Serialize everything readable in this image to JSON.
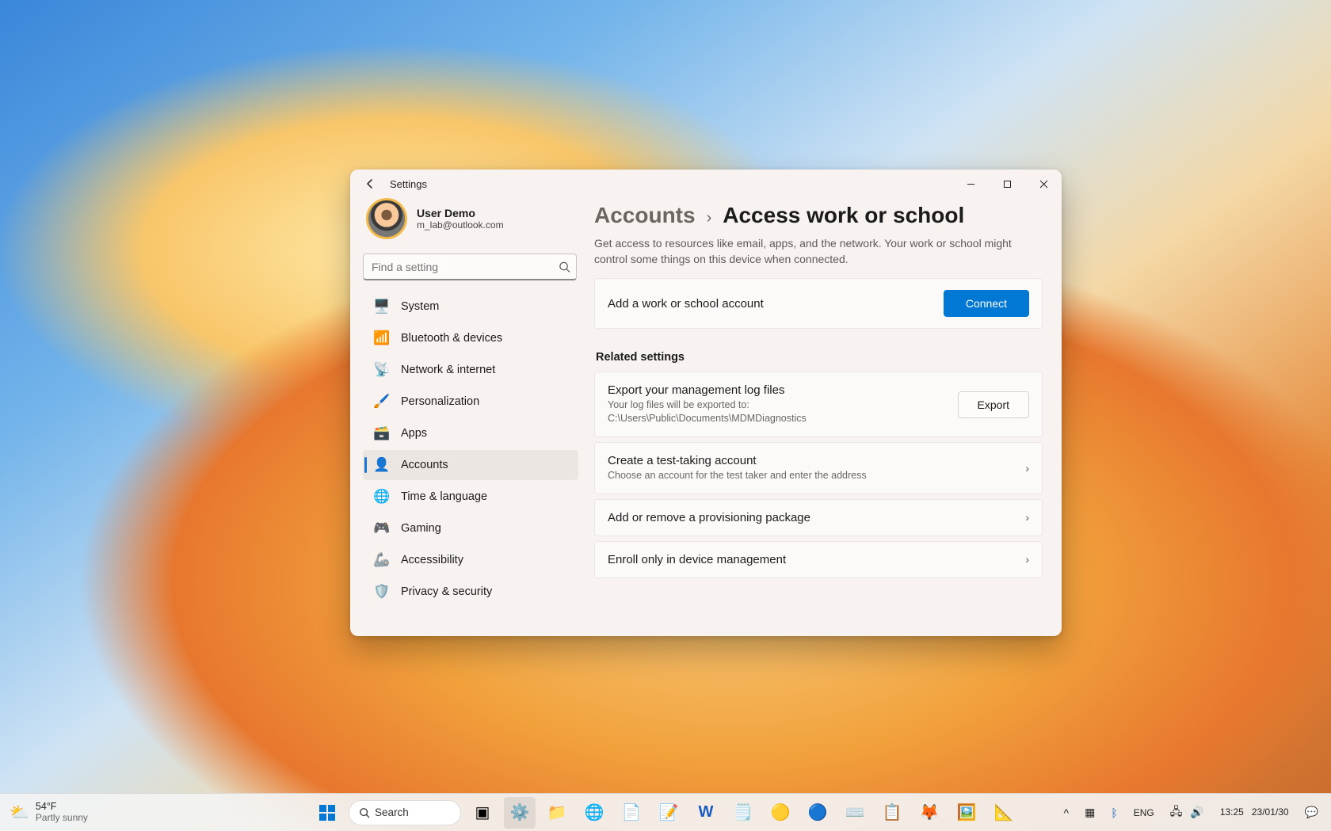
{
  "window": {
    "app_title": "Settings",
    "controls": {
      "minimize": "–",
      "maximize": "▢",
      "close": "✕"
    }
  },
  "profile": {
    "name": "User Demo",
    "email": "m_lab@outlook.com"
  },
  "search": {
    "placeholder": "Find a setting"
  },
  "sidebar": {
    "items": [
      {
        "id": "system",
        "label": "System",
        "glyph": "🖥️"
      },
      {
        "id": "bluetooth",
        "label": "Bluetooth & devices",
        "glyph": "📶"
      },
      {
        "id": "network",
        "label": "Network & internet",
        "glyph": "📡"
      },
      {
        "id": "personalization",
        "label": "Personalization",
        "glyph": "🖌️"
      },
      {
        "id": "apps",
        "label": "Apps",
        "glyph": "🗃️"
      },
      {
        "id": "accounts",
        "label": "Accounts",
        "glyph": "👤",
        "selected": true
      },
      {
        "id": "time",
        "label": "Time & language",
        "glyph": "🌐"
      },
      {
        "id": "gaming",
        "label": "Gaming",
        "glyph": "🎮"
      },
      {
        "id": "accessibility",
        "label": "Accessibility",
        "glyph": "🦾"
      },
      {
        "id": "privacy",
        "label": "Privacy & security",
        "glyph": "🛡️"
      }
    ]
  },
  "breadcrumb": {
    "parent": "Accounts",
    "chevron": "›",
    "current": "Access work or school"
  },
  "description": "Get access to resources like email, apps, and the network. Your work or school might control some things on this device when connected.",
  "add_card": {
    "title": "Add a work or school account",
    "button": "Connect"
  },
  "related_heading": "Related settings",
  "related": [
    {
      "id": "export",
      "title": "Export your management log files",
      "sub": "Your log files will be exported to: C:\\Users\\Public\\Documents\\MDMDiagnostics",
      "button": "Export",
      "has_chevron": false
    },
    {
      "id": "test-account",
      "title": "Create a test-taking account",
      "sub": "Choose an account for the test taker and enter the address",
      "has_chevron": true
    },
    {
      "id": "provisioning",
      "title": "Add or remove a provisioning package",
      "has_chevron": true
    },
    {
      "id": "enroll",
      "title": "Enroll only in device management",
      "has_chevron": true
    }
  ],
  "taskbar": {
    "weather": {
      "temp": "54°F",
      "cond": "Partly sunny"
    },
    "search_label": "Search",
    "tray": {
      "lang": "ENG",
      "time": "13:25",
      "date": "23/01/30"
    }
  }
}
